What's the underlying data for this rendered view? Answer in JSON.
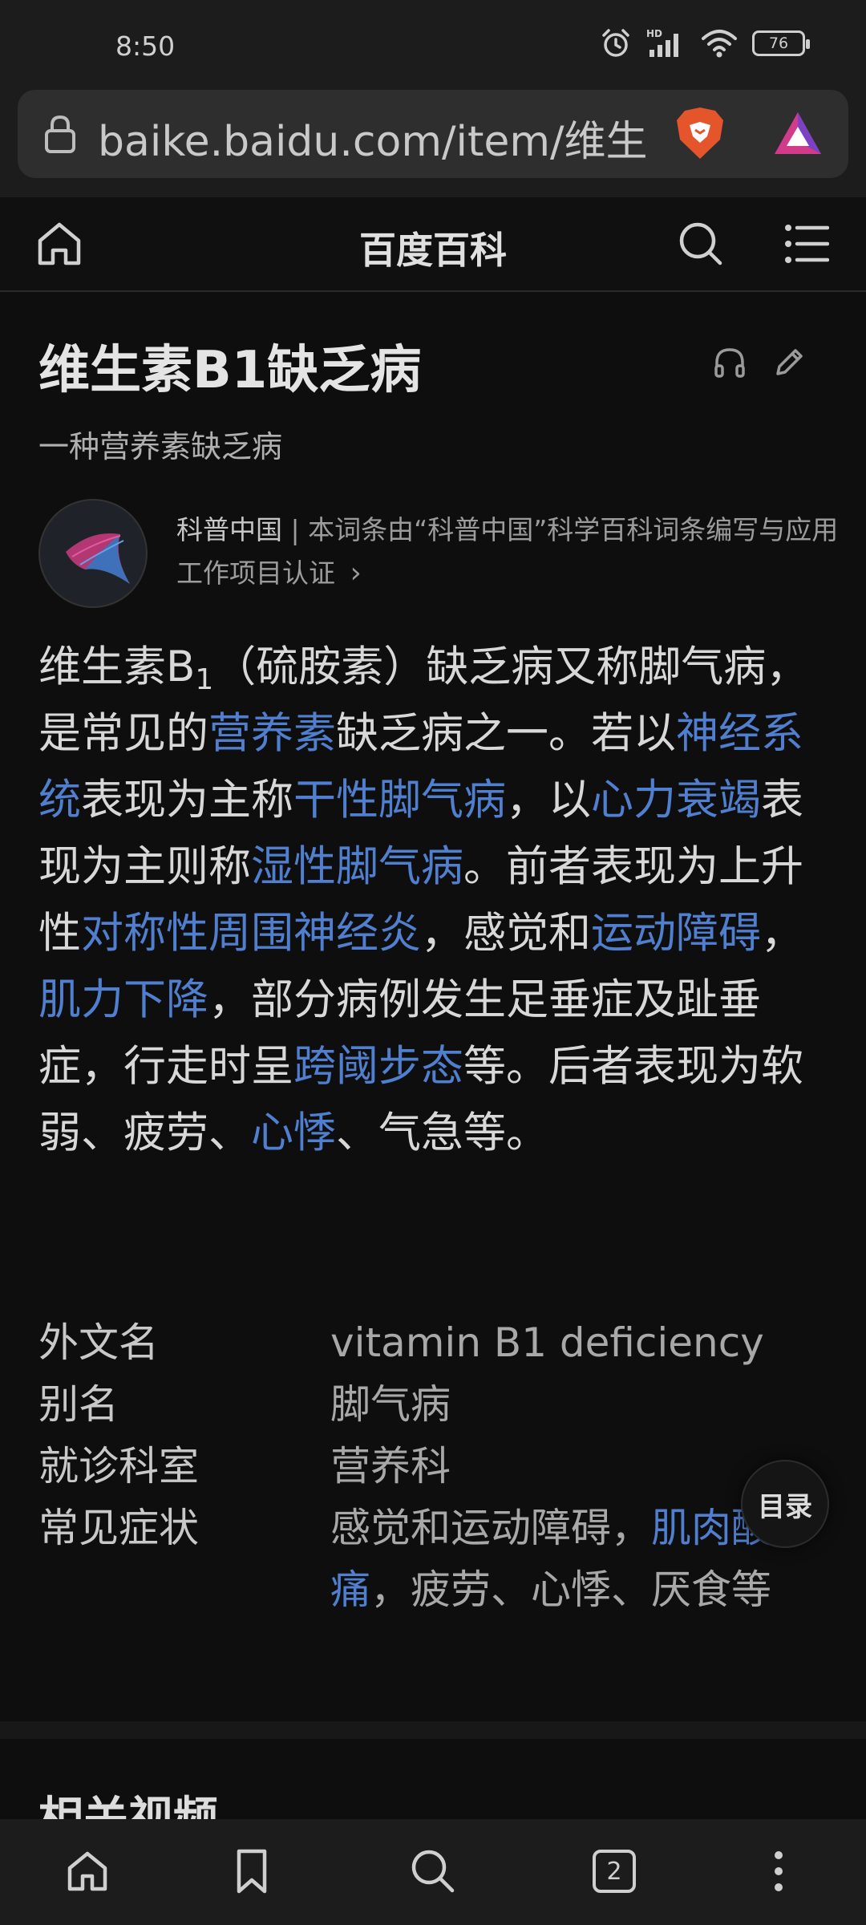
{
  "status_bar": {
    "time": "8:50",
    "battery": "76",
    "icons": [
      "alarm-icon",
      "hd-signal-icon",
      "wifi-icon",
      "battery-icon"
    ]
  },
  "browser": {
    "url": "baike.baidu.com/item/维生",
    "icons": [
      "lock-icon",
      "brave-shield-icon",
      "brave-rewards-icon"
    ]
  },
  "site_header": {
    "title": "百度百科",
    "icons": [
      "home-icon",
      "search-icon",
      "menu-icon"
    ]
  },
  "article": {
    "title": "维生素B1缺乏病",
    "subtitle": "一种营养素缺乏病",
    "source": {
      "name": "科普中国",
      "separator": " | ",
      "text": "本词条由“科普中国”科学百科词条编写与应用工作项目认证",
      "arrow": "›"
    },
    "summary": {
      "p1": "维生素B",
      "sub": "1",
      "p2": "（硫胺素）缺乏病又称脚气病，是常见的",
      "l1": "营养素",
      "p3": "缺乏病之一。若以",
      "l2": "神经系统",
      "p4": "表现为主称",
      "l3": "干性脚气病",
      "p5": "，以",
      "l4": "心力衰竭",
      "p6": "表现为主则称",
      "l5": "湿性脚气病",
      "p7": "。前者表现为上升性",
      "l6": "对称性周围神经炎",
      "p8": "，感觉和",
      "l7": "运动障碍",
      "p9": "，",
      "l8": "肌力下降",
      "p10": "，部分病例发生足垂症及趾垂症，行走时呈",
      "l9": "跨阈步态",
      "p11": "等。后者表现为软弱、疲劳、",
      "l10": "心悸",
      "p12": "、气急等。"
    },
    "infobox": [
      {
        "key": "外文名",
        "value": "vitamin B1 deficiency"
      },
      {
        "key": "别名",
        "value": "脚气病"
      },
      {
        "key": "就诊科室",
        "value": "营养科"
      },
      {
        "key": "常见症状",
        "value_pre": "感觉和运动障碍，",
        "value_link": "肌肉酸痛",
        "value_post": "，疲劳、心悸、厌食等"
      }
    ],
    "toc_label": "目录",
    "related_title": "相关视频"
  },
  "bottom_bar": {
    "tab_count": "2",
    "icons": [
      "home-icon",
      "bookmark-icon",
      "search-icon",
      "tabs-icon",
      "more-icon"
    ]
  }
}
